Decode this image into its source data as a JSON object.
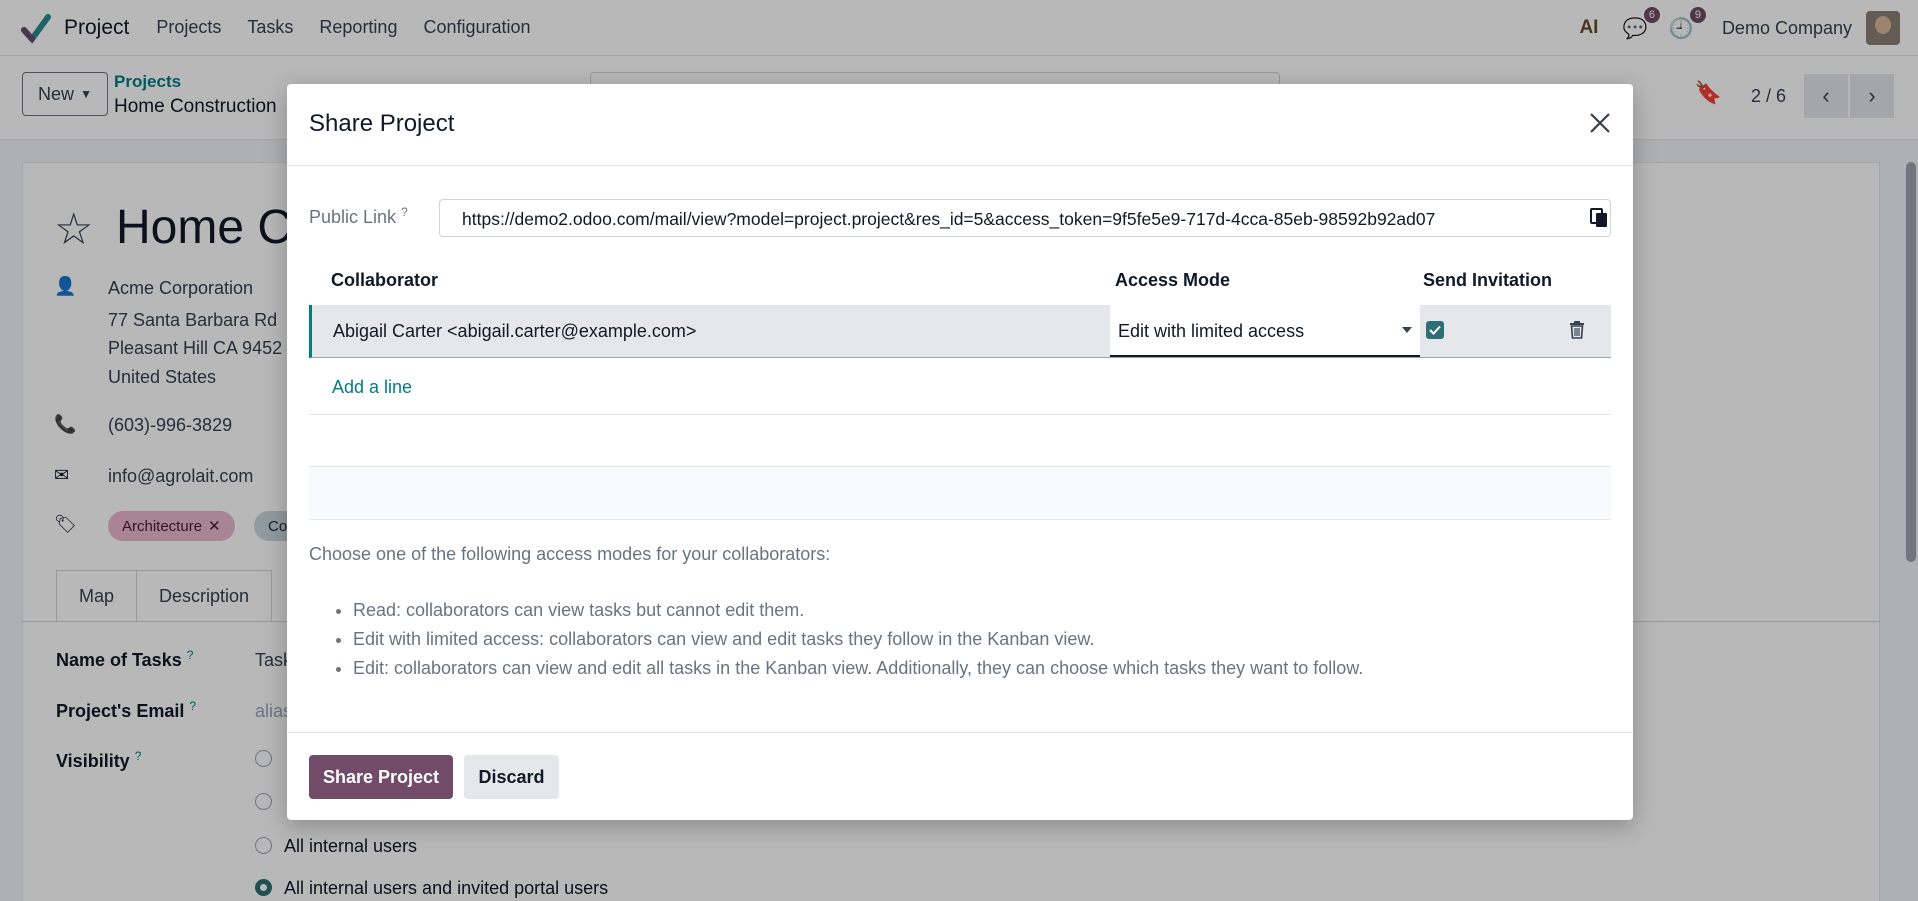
{
  "navbar": {
    "brand": "Project",
    "menu": [
      "Projects",
      "Tasks",
      "Reporting",
      "Configuration"
    ],
    "ai_label": "AI",
    "messages_badge": "6",
    "activity_badge": "9",
    "company": "Demo Company"
  },
  "control_panel": {
    "new_label": "New",
    "breadcrumb_parent": "Projects",
    "breadcrumb_current": "Home Construction",
    "pager": "2 / 6"
  },
  "form": {
    "title": "Home Co",
    "customer": "Acme Corporation",
    "address": [
      "77 Santa Barbara Rd",
      "Pleasant Hill CA 9452",
      "United States"
    ],
    "phone": "(603)-996-3829",
    "email": "info@agrolait.com",
    "tags": [
      "Architecture",
      "Co"
    ],
    "tabs": [
      "Map",
      "Description"
    ],
    "fields": [
      {
        "label": "Name of Tasks",
        "value": "Task"
      },
      {
        "label": "Project's Email",
        "value": "alias"
      },
      {
        "label": "Visibility",
        "value": ""
      }
    ],
    "visibility_options": [
      {
        "label": "",
        "checked": false
      },
      {
        "label": "",
        "checked": false
      },
      {
        "label": "All internal users",
        "checked": false
      },
      {
        "label": "All internal users and invited portal users",
        "checked": true
      }
    ]
  },
  "dialog": {
    "title": "Share Project",
    "public_link_label": "Public Link",
    "help_mark": "?",
    "public_link": "https://demo2.odoo.com/mail/view?model=project.project&res_id=5&access_token=9f5fe5e9-717d-4cca-85eb-98592b92ad07",
    "columns": {
      "collaborator": "Collaborator",
      "access_mode": "Access Mode",
      "send_invitation": "Send Invitation"
    },
    "rows": [
      {
        "collaborator": "Abigail Carter <abigail.carter@example.com>",
        "access_mode": "Edit with limited access",
        "send_invitation": true
      }
    ],
    "add_line": "Add a line",
    "help_intro": "Choose one of the following access modes for your collaborators:",
    "help_items": [
      "Read: collaborators can view tasks but cannot edit them.",
      "Edit with limited access: collaborators can view and edit tasks they follow in the Kanban view.",
      "Edit: collaborators can view and edit all tasks in the Kanban view. Additionally, they can choose which tasks they want to follow."
    ],
    "share_button": "Share Project",
    "discard_button": "Discard"
  },
  "colors": {
    "primary": "#714b67",
    "link": "#017e84",
    "checkbox": "#2e6f73"
  }
}
